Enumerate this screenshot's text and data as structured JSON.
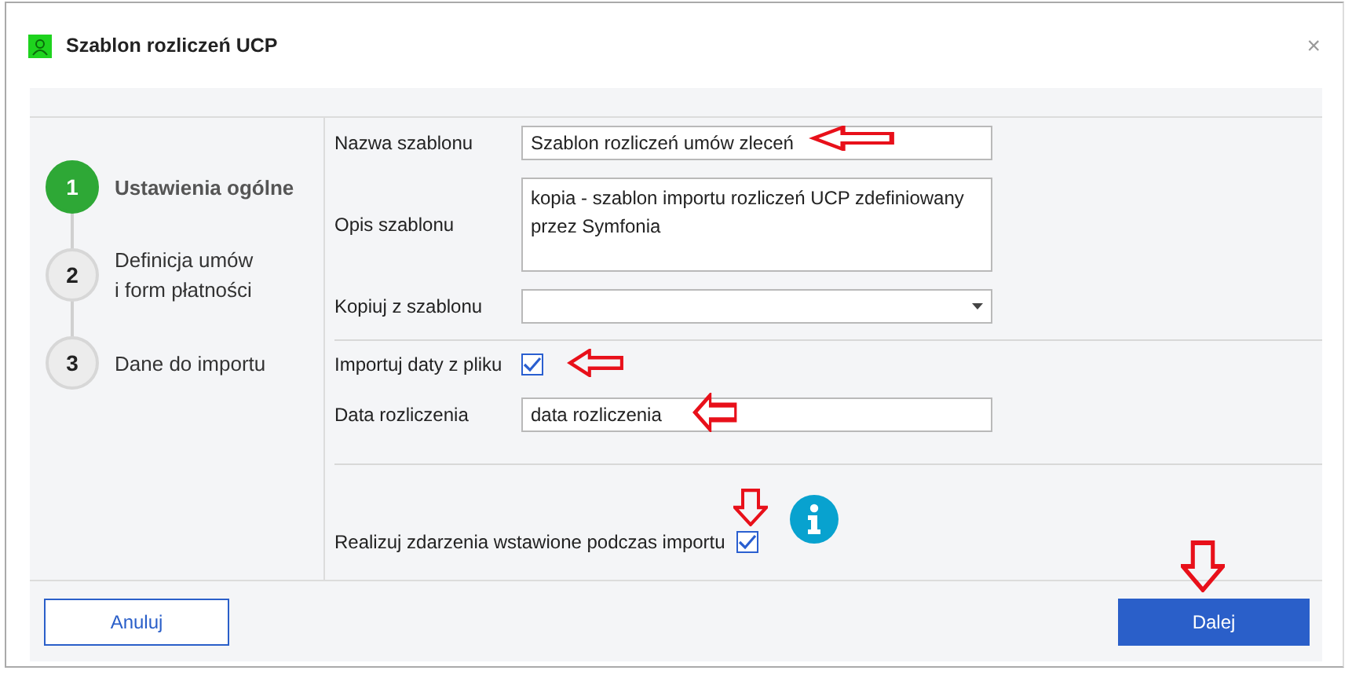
{
  "window": {
    "title": "Szablon rozliczeń UCP",
    "close": "×"
  },
  "steps": [
    {
      "number": "1",
      "label": "Ustawienia ogólne",
      "selected": true
    },
    {
      "number": "2",
      "label": "Definicja umów\ni form płatności",
      "selected": false
    },
    {
      "number": "3",
      "label": "Dane do importu",
      "selected": false
    }
  ],
  "sections": [
    [
      {
        "kind": "text",
        "label": "Nazwa szablonu",
        "value": "Szablon rozliczeń umów zleceń"
      },
      {
        "kind": "textarea",
        "label": "Opis szablonu",
        "value": "kopia - szablon importu rozliczeń UCP zdefiniowany przez Symfonia"
      },
      {
        "kind": "dropdown",
        "label": "Kopiuj z szablonu"
      }
    ],
    [
      {
        "kind": "checkbox",
        "label": "Importuj daty z pliku",
        "checked": true
      },
      {
        "kind": "text",
        "label": "Data rozliczenia",
        "value": "data rozliczenia"
      }
    ],
    [
      {
        "kind": "checkbox",
        "label": "Realizuj zdarzenia wstawione podczas importu",
        "checked": true,
        "info": true
      }
    ]
  ],
  "buttons": {
    "cancel": "Anuluj",
    "next": "Dalej"
  }
}
